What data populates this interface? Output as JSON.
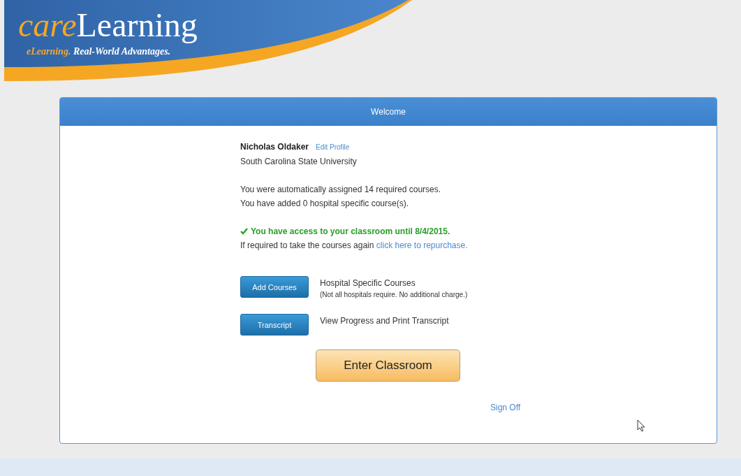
{
  "logo": {
    "brand_first": "care",
    "brand_second": "Learning",
    "tagline_first": "eLearning.",
    "tagline_second": "Real-World Advantages."
  },
  "panel": {
    "title": "Welcome",
    "user": {
      "name": "Nicholas Oldaker",
      "edit_link": "Edit Profile",
      "organization": "South Carolina State University"
    },
    "course_lines": [
      "You were automatically assigned 14 required courses.",
      "You have added 0 hospital specific course(s)."
    ],
    "access": {
      "granted": true,
      "text": "You have access to your classroom until 8/4/2015."
    },
    "repurchase": {
      "text": "If required to take the courses again ",
      "link": "click here to repurchase."
    },
    "actions": [
      {
        "button": "Add Courses",
        "title": "Hospital Specific Courses",
        "note": "(Not all hospitals require. No additional charge.)"
      },
      {
        "button": "Transcript",
        "title": "View Progress and Print Transcript"
      }
    ],
    "primary_button": "Enter Classroom",
    "sign_off": "Sign Off"
  }
}
